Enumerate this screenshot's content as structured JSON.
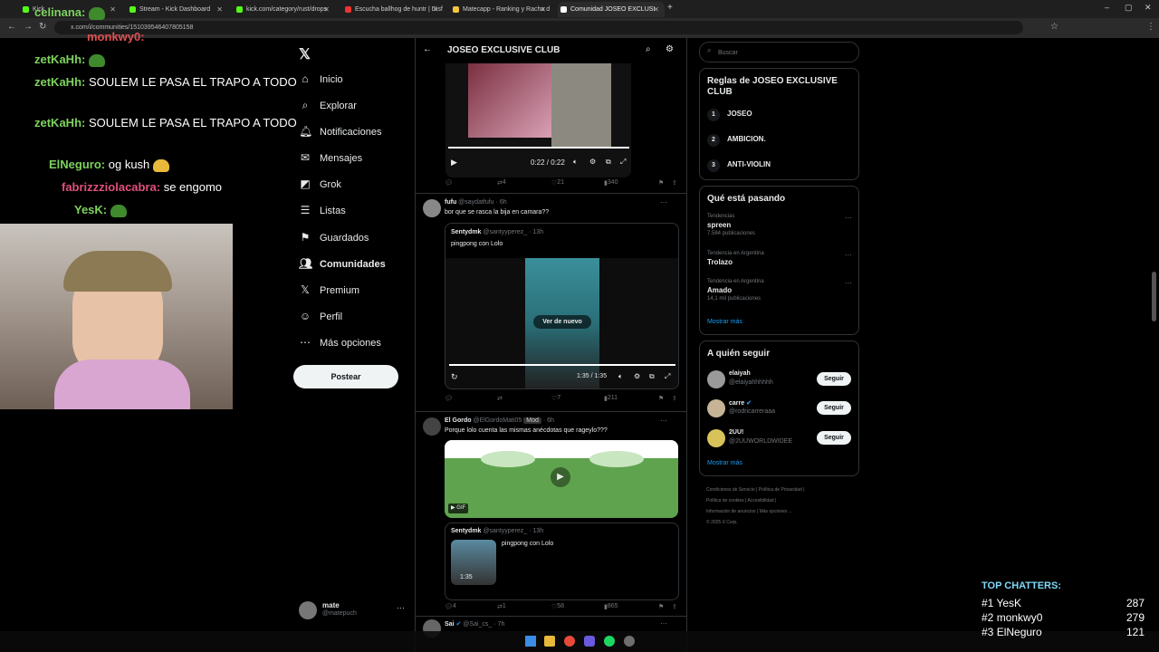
{
  "browser": {
    "tabs": [
      {
        "label": "Kick"
      },
      {
        "label": "Stream - Kick Dashboard"
      },
      {
        "label": "kick.com/category/rust/drops"
      },
      {
        "label": "Escucha ballhog de huntr | Disf"
      },
      {
        "label": "Matecapp - Ranking y Racha d"
      },
      {
        "label": "Comunidad JOSEO EXCLUSI"
      }
    ],
    "url": "x.com/i/communities/1510395464078051​58"
  },
  "chat": [
    {
      "user": "celinana:",
      "msg": ""
    },
    {
      "user": "monkwy0:",
      "msg": ""
    },
    {
      "user": "zetKaHh:",
      "msg": ""
    },
    {
      "user": "zetKaHh:",
      "msg": "SOULEM LE PASA EL TRAPO A TODO"
    },
    {
      "user": "zetKaHh:",
      "msg": "SOULEM LE PASA EL TRAPO A TODO"
    },
    {
      "user": "ElNeguro:",
      "msg": "og kush"
    },
    {
      "user": "fabrizzziolacabra:",
      "msg": "se engomo"
    },
    {
      "user": "YesK:",
      "msg": ""
    }
  ],
  "sidebar": {
    "items": [
      {
        "label": "Inicio",
        "icon": "home-icon"
      },
      {
        "label": "Explorar",
        "icon": "search-icon"
      },
      {
        "label": "Notificaciones",
        "icon": "bell-icon"
      },
      {
        "label": "Mensajes",
        "icon": "mail-icon"
      },
      {
        "label": "Grok",
        "icon": "grok-icon"
      },
      {
        "label": "Listas",
        "icon": "list-icon"
      },
      {
        "label": "Guardados",
        "icon": "bookmark-icon"
      },
      {
        "label": "Comunidades",
        "icon": "communities-icon"
      },
      {
        "label": "Premium",
        "icon": "x-icon"
      },
      {
        "label": "Perfil",
        "icon": "person-icon"
      },
      {
        "label": "Más opciones",
        "icon": "more-icon"
      }
    ],
    "post_label": "Postear",
    "account": {
      "name": "mate",
      "handle": "@matepuch"
    }
  },
  "header": {
    "title": "JOSEO EXCLUSIVE CLUB"
  },
  "tweets": [
    {
      "video_time": "0:22 / 0:22",
      "replies": "",
      "retweets": "4",
      "likes": "21",
      "views": "340"
    },
    {
      "name": "fufu",
      "handle": "@saydatfufu",
      "time": "6h",
      "text": "bor que se rasca la bija en camara??",
      "quote_name": "Sentydmk",
      "quote_handle": "@santyyperez_",
      "quote_time": "13h",
      "quote_text": "pingpong con Lolo",
      "overlay": "Ver de nuevo",
      "video_time": "1:35 / 1:35",
      "replies": "",
      "retweets": "",
      "likes": "7",
      "views": "211"
    },
    {
      "name": "El Gordo",
      "handle": "@ElGordoMati05",
      "badge": "Mod",
      "time": "6h",
      "text": "Porque lolo cuenta las mismas anécdotas que rageylo???",
      "gif": "GIF",
      "quote_name": "Sentydmk",
      "quote_handle": "@santyyperez_",
      "quote_time": "13h",
      "quote_text": "pingpong con Lolo",
      "quote_duration": "1:35",
      "replies": "4",
      "retweets": "1",
      "likes": "58",
      "views": "865"
    },
    {
      "name": "Sai",
      "handle": "@Sai_cs_",
      "time": "7h"
    }
  ],
  "right": {
    "search_placeholder": "Buscar",
    "rules_title": "Reglas de JOSEO EXCLUSIVE CLUB",
    "rules": [
      {
        "num": "1",
        "text": "JOSEO"
      },
      {
        "num": "2",
        "text": "AMBICION."
      },
      {
        "num": "3",
        "text": "ANTI-VIOLIN"
      }
    ],
    "trends_title": "Qué está pasando",
    "trends": [
      {
        "context": "Tendencias",
        "name": "spreen",
        "count": "7.584 publicaciones"
      },
      {
        "context": "Tendencia en Argentina",
        "name": "Trolazo",
        "count": ""
      },
      {
        "context": "Tendencia en Argentina",
        "name": "Amado",
        "count": "14,1 mil publicaciones"
      }
    ],
    "show_more": "Mostrar más",
    "follow_title": "A quién seguir",
    "follow": [
      {
        "name": "elaiyah",
        "handle": "@elaiyahhhhhh",
        "button": "Seguir"
      },
      {
        "name": "carre",
        "handle": "@rodricarreraaa",
        "button": "Seguir"
      },
      {
        "name": "2UU!",
        "handle": "@2UUWORLDWIDEE",
        "button": "Seguir"
      }
    ],
    "footer": [
      "Condiciones de Servicio",
      "Política de Privacidad",
      "Política de cookies",
      "Accesibilidad",
      "Información de anuncios",
      "Más opciones ...",
      "© 2025 X Corp."
    ]
  },
  "top_chatters": {
    "title": "TOP CHATTERS:",
    "rows": [
      {
        "rank": "#1",
        "name": "YesK",
        "score": "287"
      },
      {
        "rank": "#2",
        "name": "monkwy0",
        "score": "279"
      },
      {
        "rank": "#3",
        "name": "ElNeguro",
        "score": "121"
      }
    ]
  },
  "colors": {
    "accent": "#1d9bf0",
    "chat_user": "#7dd35d",
    "chatters_title": "#7fd8f7"
  }
}
